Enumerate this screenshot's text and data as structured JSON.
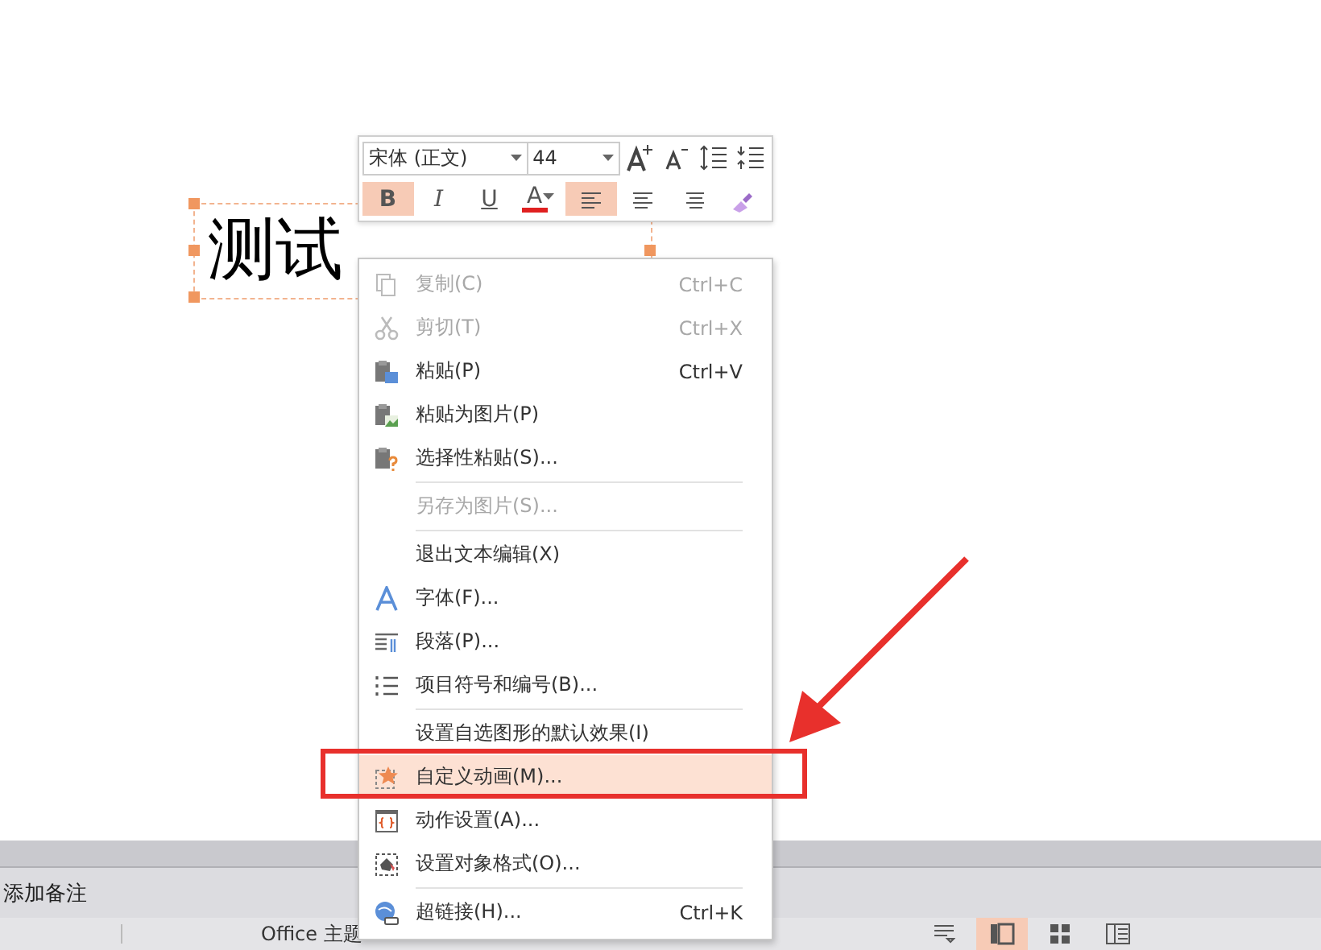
{
  "slide": {
    "text": "测试"
  },
  "mini_toolbar": {
    "font": "宋体 (正文)",
    "size": "44",
    "format_buttons": [
      {
        "kind": "bold",
        "label": "B",
        "selected": true
      },
      {
        "kind": "italic",
        "label": "I",
        "selected": false
      },
      {
        "kind": "underline",
        "label": "U",
        "selected": false
      },
      {
        "kind": "color",
        "label": "A",
        "selected": false,
        "color": "#e02020"
      },
      {
        "kind": "align-left",
        "selected": true
      },
      {
        "kind": "align-center",
        "selected": false
      },
      {
        "kind": "align-right",
        "selected": false
      },
      {
        "kind": "painter",
        "selected": false
      }
    ]
  },
  "context_menu": [
    {
      "kind": "item",
      "label": "复制(C)",
      "shortcut": "Ctrl+C",
      "disabled": true,
      "selected": false
    },
    {
      "kind": "item",
      "label": "剪切(T)",
      "shortcut": "Ctrl+X",
      "disabled": true,
      "selected": false
    },
    {
      "kind": "item",
      "label": "粘贴(P)",
      "shortcut": "Ctrl+V",
      "disabled": false,
      "selected": false
    },
    {
      "kind": "item",
      "label": "粘贴为图片(P)",
      "disabled": false,
      "selected": false
    },
    {
      "kind": "item",
      "label": "选择性粘贴(S)...",
      "disabled": false,
      "selected": false
    },
    {
      "kind": "separator"
    },
    {
      "kind": "item",
      "label": "另存为图片(S)...",
      "disabled": true,
      "selected": false
    },
    {
      "kind": "separator"
    },
    {
      "kind": "item",
      "label": "退出文本编辑(X)",
      "disabled": false,
      "selected": false
    },
    {
      "kind": "item",
      "label": "字体(F)...",
      "disabled": false,
      "selected": false
    },
    {
      "kind": "item",
      "label": "段落(P)...",
      "disabled": false,
      "selected": false
    },
    {
      "kind": "item",
      "label": "项目符号和编号(B)...",
      "disabled": false,
      "selected": false
    },
    {
      "kind": "separator"
    },
    {
      "kind": "item",
      "label": "设置自选图形的默认效果(I)",
      "disabled": false,
      "selected": false
    },
    {
      "kind": "item",
      "label": "自定义动画(M)...",
      "disabled": false,
      "selected": true
    },
    {
      "kind": "item",
      "label": "动作设置(A)...",
      "disabled": false,
      "selected": false
    },
    {
      "kind": "item",
      "label": "设置对象格式(O)...",
      "disabled": false,
      "selected": false
    },
    {
      "kind": "separator"
    },
    {
      "kind": "item",
      "label": "超链接(H)...",
      "shortcut": "Ctrl+K",
      "disabled": false,
      "selected": false
    }
  ],
  "notes": {
    "placeholder": "添加备注"
  },
  "status_bar": {
    "theme": "Office 主题",
    "views": [
      {
        "selected": false
      },
      {
        "selected": true
      },
      {
        "selected": false
      },
      {
        "selected": false
      }
    ]
  }
}
